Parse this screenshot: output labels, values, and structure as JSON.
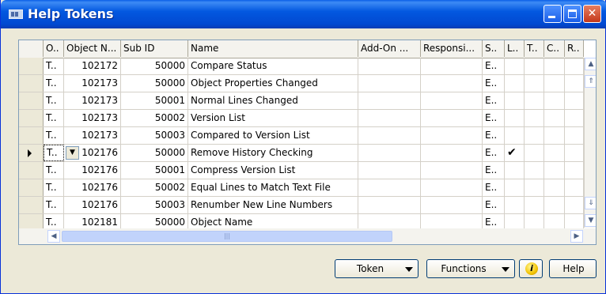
{
  "window": {
    "title": "Help Tokens"
  },
  "columns": [
    "O..",
    "Object N...",
    "Sub ID",
    "Name",
    "Add-On ...",
    "Responsi...",
    "S..",
    "L..",
    "T..",
    "C..",
    "R.."
  ],
  "rows": [
    {
      "type": "T..",
      "object_no": "102172",
      "sub_id": "50000",
      "name": "Compare Status",
      "s": "E..",
      "l": ""
    },
    {
      "type": "T..",
      "object_no": "102173",
      "sub_id": "50000",
      "name": "Object Properties Changed",
      "s": "E..",
      "l": ""
    },
    {
      "type": "T..",
      "object_no": "102173",
      "sub_id": "50001",
      "name": "Normal Lines Changed",
      "s": "E..",
      "l": ""
    },
    {
      "type": "T..",
      "object_no": "102173",
      "sub_id": "50002",
      "name": "Version List",
      "s": "E..",
      "l": ""
    },
    {
      "type": "T..",
      "object_no": "102173",
      "sub_id": "50003",
      "name": "Compared to Version List",
      "s": "E..",
      "l": ""
    },
    {
      "type": "T..",
      "object_no": "102176",
      "sub_id": "50000",
      "name": "Remove History Checking",
      "s": "E..",
      "l": "✔",
      "current": true
    },
    {
      "type": "T..",
      "object_no": "102176",
      "sub_id": "50001",
      "name": "Compress Version List",
      "s": "E..",
      "l": ""
    },
    {
      "type": "T..",
      "object_no": "102176",
      "sub_id": "50002",
      "name": "Equal Lines to Match Text File",
      "s": "E..",
      "l": ""
    },
    {
      "type": "T..",
      "object_no": "102176",
      "sub_id": "50003",
      "name": "Renumber New Line Numbers",
      "s": "E..",
      "l": ""
    },
    {
      "type": "T..",
      "object_no": "102181",
      "sub_id": "50000",
      "name": "Object Name",
      "s": "E..",
      "l": ""
    }
  ],
  "buttons": {
    "token": "Token",
    "functions": "Functions",
    "help": "Help"
  },
  "icons": {
    "info": "info-icon",
    "app": "form-icon"
  },
  "colors": {
    "titlebar": "#0358e0",
    "grid_border": "#7f9db9"
  }
}
